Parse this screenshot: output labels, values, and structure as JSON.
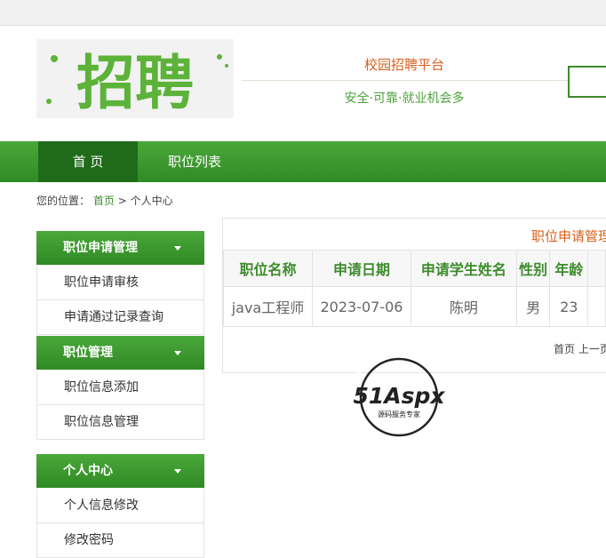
{
  "header": {
    "logo_text": "招聘",
    "site_title": "校园招聘平台",
    "site_subtitle": "安全·可靠·就业机会多"
  },
  "nav": {
    "home": "首 页",
    "jobs": "职位列表"
  },
  "breadcrumb": {
    "prefix": "您的位置：",
    "home": "首页",
    "separator": ">",
    "current": "个人中心"
  },
  "sidebar": {
    "groups": [
      {
        "title": "职位申请管理",
        "items": [
          "职位申请审核",
          "申请通过记录查询"
        ]
      },
      {
        "title": "职位管理",
        "items": [
          "职位信息添加",
          "职位信息管理"
        ]
      },
      {
        "title": "个人中心",
        "items": [
          "个人信息修改",
          "修改密码"
        ]
      }
    ]
  },
  "main": {
    "panel_title": "职位申请管理",
    "table": {
      "headers": [
        "职位名称",
        "申请日期",
        "申请学生姓名",
        "性别",
        "年龄"
      ],
      "rows": [
        [
          "java工程师",
          "2023-07-06",
          "陈明",
          "男",
          "23"
        ]
      ]
    },
    "pager": "首页 上一页"
  },
  "watermark": {
    "brand": "51Aspx",
    "tagline": "源码服务专家"
  },
  "colors": {
    "brand_green": "#3d8b2c",
    "accent_orange": "#d9601d"
  }
}
